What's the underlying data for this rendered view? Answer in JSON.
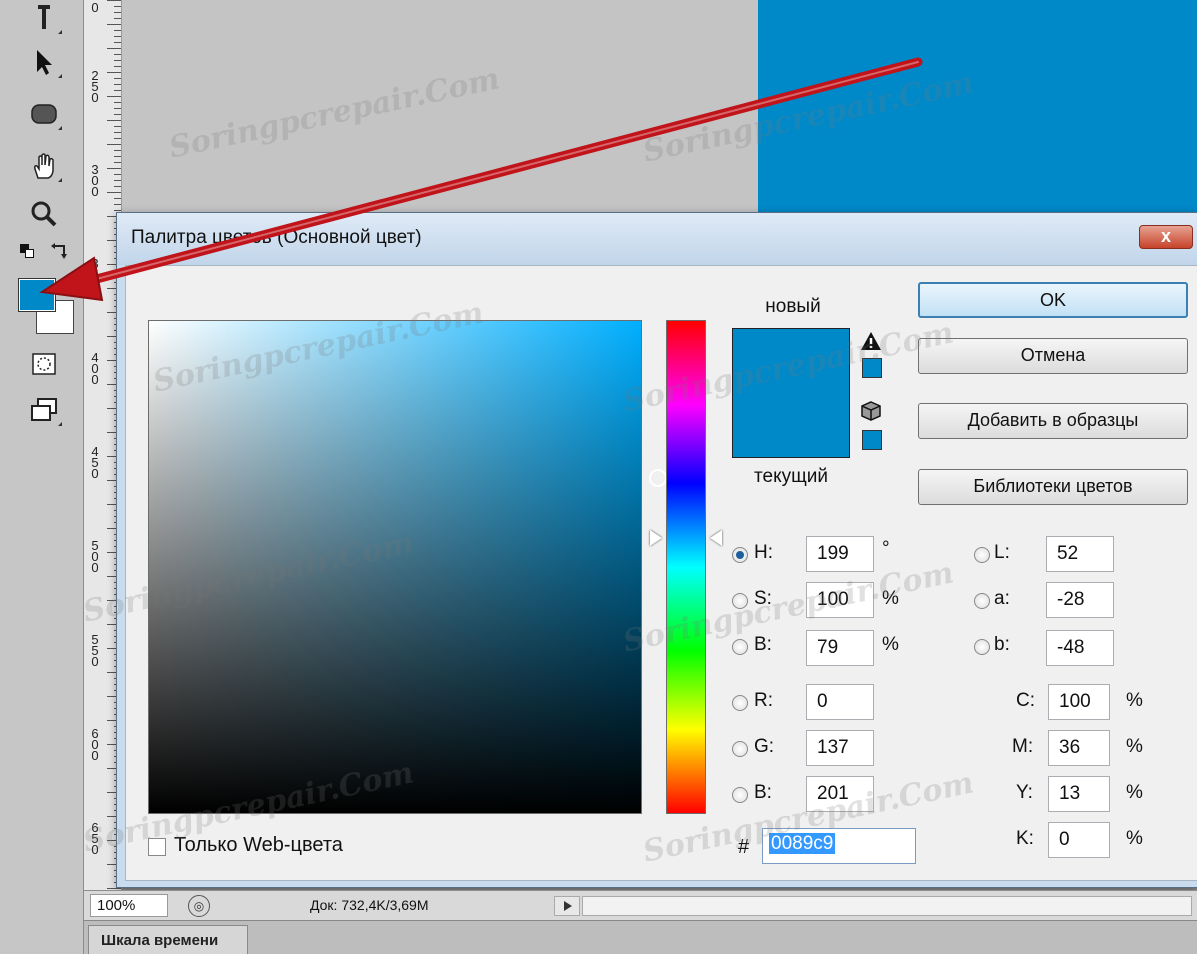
{
  "toolbar": {
    "tools": [
      "type-tool-icon",
      "path-selection-icon",
      "rounded-rectangle-icon",
      "hand-tool-icon",
      "zoom-tool-icon",
      "default-colors-icon",
      "swap-colors-icon",
      "foreground-color-swatch",
      "background-color-swatch",
      "quick-mask-icon",
      "screen-mode-icon"
    ],
    "foreground_color": "#0089c9",
    "background_color": "#ffffff"
  },
  "ruler": {
    "labels": [
      "250",
      "300",
      "350",
      "400",
      "450",
      "500",
      "550",
      "600",
      "650"
    ]
  },
  "canvas": {
    "gray_color": "#c4c4c4",
    "blue_color": "#0089c9"
  },
  "dialog": {
    "title": "Палитра цветов (Основной цвет)",
    "close_label": "x",
    "labels": {
      "new": "новый",
      "current": "текущий"
    },
    "buttons": {
      "ok": "OK",
      "cancel": "Отмена",
      "add_to_swatches": "Добавить в образцы",
      "color_libraries": "Библиотеки цветов"
    },
    "hsb": {
      "h": {
        "label": "H:",
        "value": "199",
        "unit": "°"
      },
      "s": {
        "label": "S:",
        "value": "100",
        "unit": "%"
      },
      "b": {
        "label": "B:",
        "value": "79",
        "unit": "%"
      }
    },
    "rgb": {
      "r": {
        "label": "R:",
        "value": "0"
      },
      "g": {
        "label": "G:",
        "value": "137"
      },
      "b": {
        "label": "B:",
        "value": "201"
      }
    },
    "lab": {
      "l": {
        "label": "L:",
        "value": "52"
      },
      "a": {
        "label": "a:",
        "value": "-28"
      },
      "b": {
        "label": "b:",
        "value": "-48"
      }
    },
    "cmyk": {
      "c": {
        "label": "C:",
        "value": "100",
        "unit": "%"
      },
      "m": {
        "label": "M:",
        "value": "36",
        "unit": "%"
      },
      "y": {
        "label": "Y:",
        "value": "13",
        "unit": "%"
      },
      "k": {
        "label": "K:",
        "value": "0",
        "unit": "%"
      }
    },
    "web_only_label": "Только Web-цвета",
    "hash_label": "#",
    "hex_value": "0089c9",
    "selected_color": "#0089c9"
  },
  "statusbar": {
    "zoom": "100%",
    "doc_info": "Док: 732,4K/3,69M"
  },
  "timeline": {
    "tab_label": "Шкала времени"
  },
  "watermark": "Soringpcrepair.Com"
}
